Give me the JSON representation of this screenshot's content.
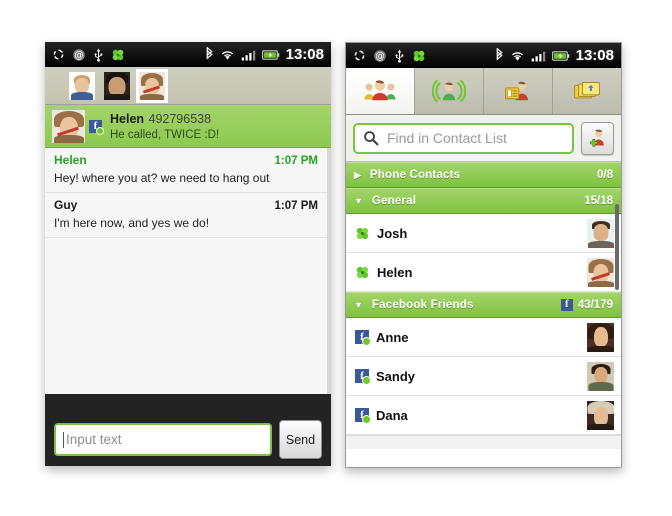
{
  "colors": {
    "accent_green": "#7dc242",
    "group_green": "#8cc94f",
    "facebook_blue": "#3b5998",
    "status_black": "#000000",
    "presence_green": "#6fc62b"
  },
  "left_phone": {
    "statusbar": {
      "icons": [
        "sync-icon",
        "email-icon",
        "usb-icon",
        "clover-icon"
      ],
      "right_icons": [
        "bluetooth-icon",
        "wifi-icon",
        "signal-icon",
        "battery-icon"
      ],
      "clock": "13:08"
    },
    "avatar_strip": {
      "avatars": [
        {
          "name": "avatar-josh",
          "selected": false
        },
        {
          "name": "avatar-guy",
          "selected": false
        },
        {
          "name": "avatar-helen",
          "selected": true
        }
      ]
    },
    "conversation_header": {
      "avatar": "helen-avatar",
      "network_icon": "facebook-icon",
      "name": "Helen",
      "number": "492796538",
      "status": "He called, TWICE :D!"
    },
    "messages": [
      {
        "author": "Helen",
        "time": "1:07 PM",
        "text": "Hey! where you at? we need to hang out",
        "side": "them"
      },
      {
        "author": "Guy",
        "time": "1:07 PM",
        "text": "I'm here now, and yes we do!",
        "side": "me"
      }
    ],
    "input_bar": {
      "placeholder": "Input text",
      "value": "",
      "send_label": "Send"
    }
  },
  "right_phone": {
    "statusbar": {
      "icons": [
        "sync-icon",
        "email-icon",
        "usb-icon",
        "clover-icon"
      ],
      "right_icons": [
        "bluetooth-icon",
        "wifi-icon",
        "signal-icon",
        "battery-icon"
      ],
      "clock": "13:08"
    },
    "tabs": [
      {
        "name": "tab-contacts",
        "icon": "contacts-group-icon",
        "active": true
      },
      {
        "name": "tab-broadcast",
        "icon": "broadcast-person-icon",
        "active": false
      },
      {
        "name": "tab-contact-card",
        "icon": "contact-card-icon",
        "active": false
      },
      {
        "name": "tab-cards-stack",
        "icon": "cards-stack-icon",
        "active": false
      }
    ],
    "search": {
      "icon": "search-icon",
      "placeholder": "Find in Contact List",
      "value": ""
    },
    "add_contact_button": {
      "icon": "add-contact-icon",
      "label": ""
    },
    "groups": [
      {
        "name": "Phone Contacts",
        "count": "0/8",
        "expanded": false,
        "arrow": "chevron-right-icon",
        "badge_icon": null,
        "contacts": []
      },
      {
        "name": "General",
        "count": "15/18",
        "expanded": true,
        "arrow": "chevron-down-icon",
        "badge_icon": null,
        "contacts": [
          {
            "name": "Josh",
            "presence": "clover-icon",
            "avatar": "josh-avatar"
          },
          {
            "name": "Helen",
            "presence": "clover-icon",
            "avatar": "helen-avatar"
          }
        ]
      },
      {
        "name": "Facebook Friends",
        "count": "43/179",
        "expanded": true,
        "arrow": "chevron-down-icon",
        "badge_icon": "facebook-icon",
        "contacts": [
          {
            "name": "Anne",
            "presence": "facebook-online-icon",
            "avatar": "anne-avatar"
          },
          {
            "name": "Sandy",
            "presence": "facebook-online-icon",
            "avatar": "sandy-avatar"
          },
          {
            "name": "Dana",
            "presence": "facebook-online-icon",
            "avatar": "dana-avatar"
          }
        ]
      }
    ]
  }
}
